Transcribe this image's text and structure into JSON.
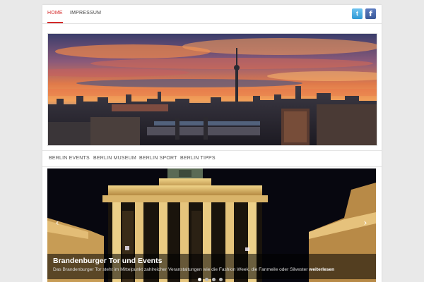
{
  "top_nav": {
    "items": [
      {
        "label": "HOME",
        "active": true
      },
      {
        "label": "IMPRESSUM",
        "active": false
      }
    ]
  },
  "social": {
    "twitter": {
      "icon": "twitter-icon",
      "glyph": "t",
      "color": "#2f9ad6"
    },
    "facebook": {
      "icon": "facebook-icon",
      "glyph": "f",
      "color": "#3b5998"
    }
  },
  "sub_nav": {
    "items": [
      "BERLIN EVENTS",
      "BERLIN MUSEUM",
      "BERLIN SPORT",
      "BERLIN TIPPS"
    ]
  },
  "slider": {
    "title": "Brandenburger Tor und Events",
    "text": "Das Brandenburger Tor steht im Mittelpunkt zahlreicher Veranstaltungen wie die Fashion Week, die Fanmeile oder Silvester",
    "more": "weiterlesen",
    "prev_icon": "chevron-left-icon",
    "next_icon": "chevron-right-icon",
    "dots": 4,
    "active_dot": 0
  },
  "colors": {
    "accent": "#d42a2a",
    "page_bg": "#e9e9e9"
  }
}
